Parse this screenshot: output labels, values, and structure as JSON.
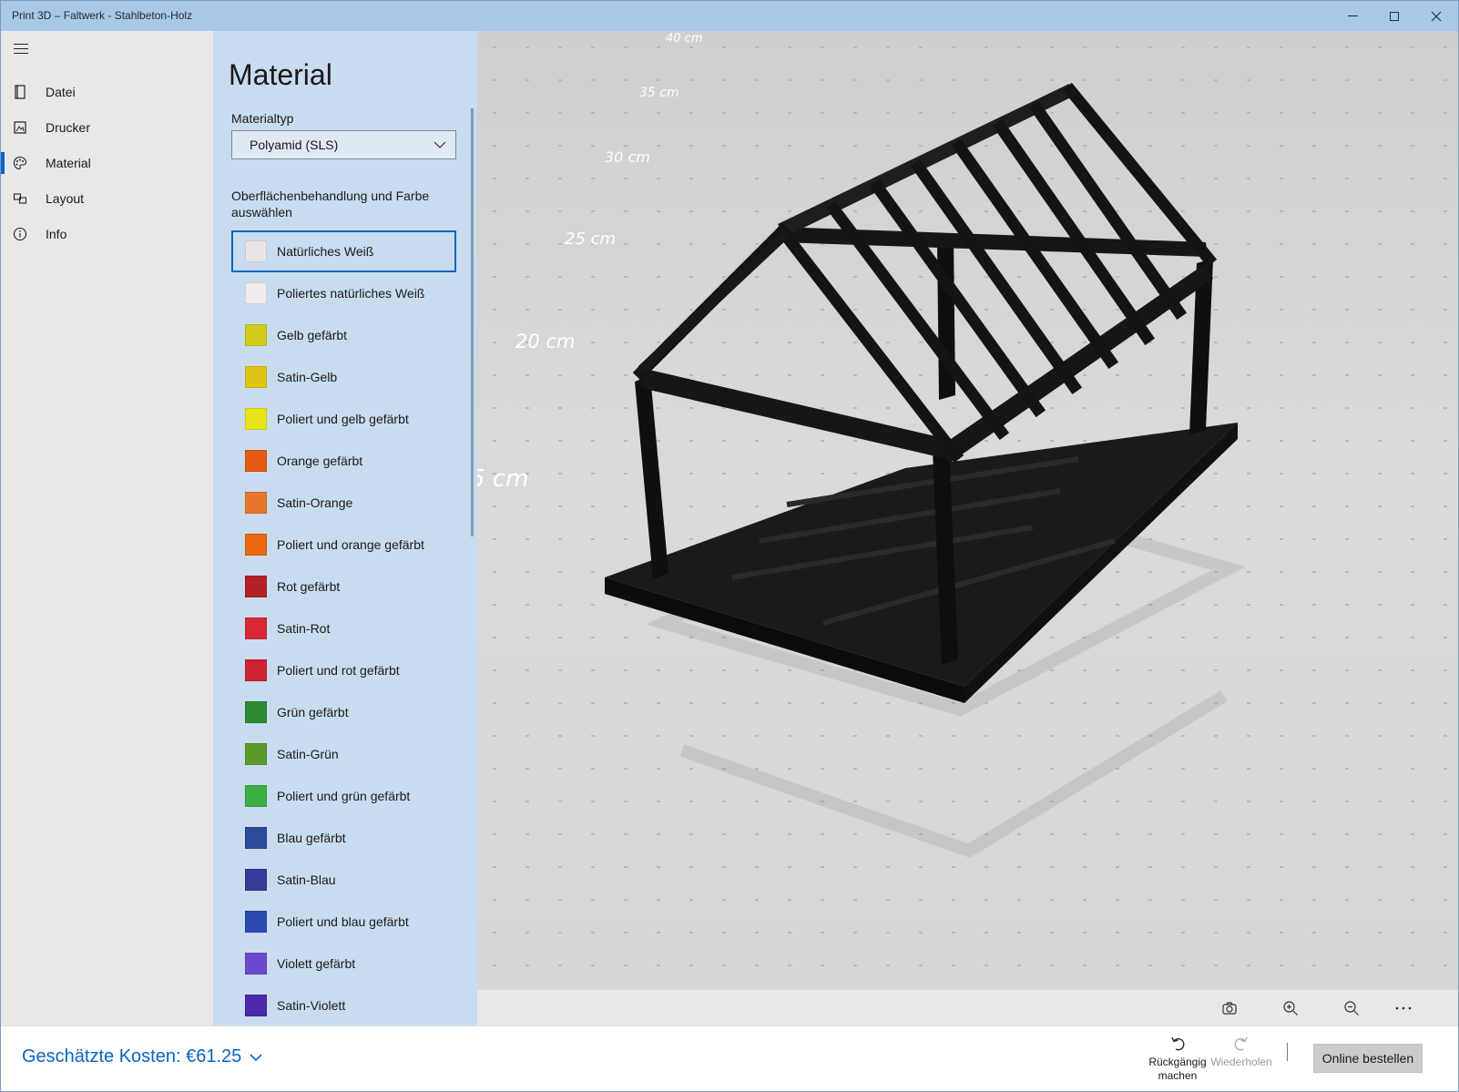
{
  "window": {
    "title": "Print 3D – Faltwerk - Stahlbeton-Holz"
  },
  "nav": {
    "items": [
      {
        "label": "Datei",
        "icon": "file-icon"
      },
      {
        "label": "Drucker",
        "icon": "printer-icon"
      },
      {
        "label": "Material",
        "icon": "palette-icon",
        "active": true
      },
      {
        "label": "Layout",
        "icon": "layout-icon"
      },
      {
        "label": "Info",
        "icon": "info-icon"
      }
    ]
  },
  "panel": {
    "title": "Material",
    "material_type_label": "Materialtyp",
    "material_type_value": "Polyamid (SLS)",
    "surface_label_line1": "Oberflächenbehandlung und Farbe",
    "surface_label_line2": "auswählen",
    "swatches": [
      {
        "label": "Natürliches Weiß",
        "color": "#e6e6e6",
        "selected": true
      },
      {
        "label": "Poliertes natürliches Weiß",
        "color": "#ececec"
      },
      {
        "label": "Gelb gefärbt",
        "color": "#d4cc1a"
      },
      {
        "label": "Satin-Gelb",
        "color": "#e0c414"
      },
      {
        "label": "Poliert und gelb gefärbt",
        "color": "#e8e61a"
      },
      {
        "label": "Orange gefärbt",
        "color": "#e85a10"
      },
      {
        "label": "Satin-Orange",
        "color": "#e8762a"
      },
      {
        "label": "Poliert und orange gefärbt",
        "color": "#e8680e"
      },
      {
        "label": "Rot gefärbt",
        "color": "#b42226"
      },
      {
        "label": "Satin-Rot",
        "color": "#d82838"
      },
      {
        "label": "Poliert und rot gefärbt",
        "color": "#cc2430"
      },
      {
        "label": "Grün gefärbt",
        "color": "#2e8a30"
      },
      {
        "label": "Satin-Grün",
        "color": "#5a9a2c"
      },
      {
        "label": "Poliert und grün gefärbt",
        "color": "#3cb044"
      },
      {
        "label": "Blau gefärbt",
        "color": "#2e4a9a"
      },
      {
        "label": "Satin-Blau",
        "color": "#3a3a9a"
      },
      {
        "label": "Poliert und blau gefärbt",
        "color": "#2c4ab0"
      },
      {
        "label": "Violett gefärbt",
        "color": "#6a4ad0"
      },
      {
        "label": "Satin-Violett",
        "color": "#4a2aa8"
      }
    ]
  },
  "viewport": {
    "ruler_labels": [
      "40 cm",
      "35 cm",
      "30 cm",
      "25 cm",
      "20 cm",
      "5 cm"
    ]
  },
  "footer": {
    "cost": "Geschätzte Kosten: €61.25",
    "undo_line1": "Rückgängig",
    "undo_line2": "machen",
    "redo": "Wiederholen",
    "order": "Online bestellen"
  },
  "colors": {
    "accent": "#0a64c2",
    "titlebar": "#a9c8e6",
    "panel": "#c9dcef",
    "model": "#141414"
  }
}
